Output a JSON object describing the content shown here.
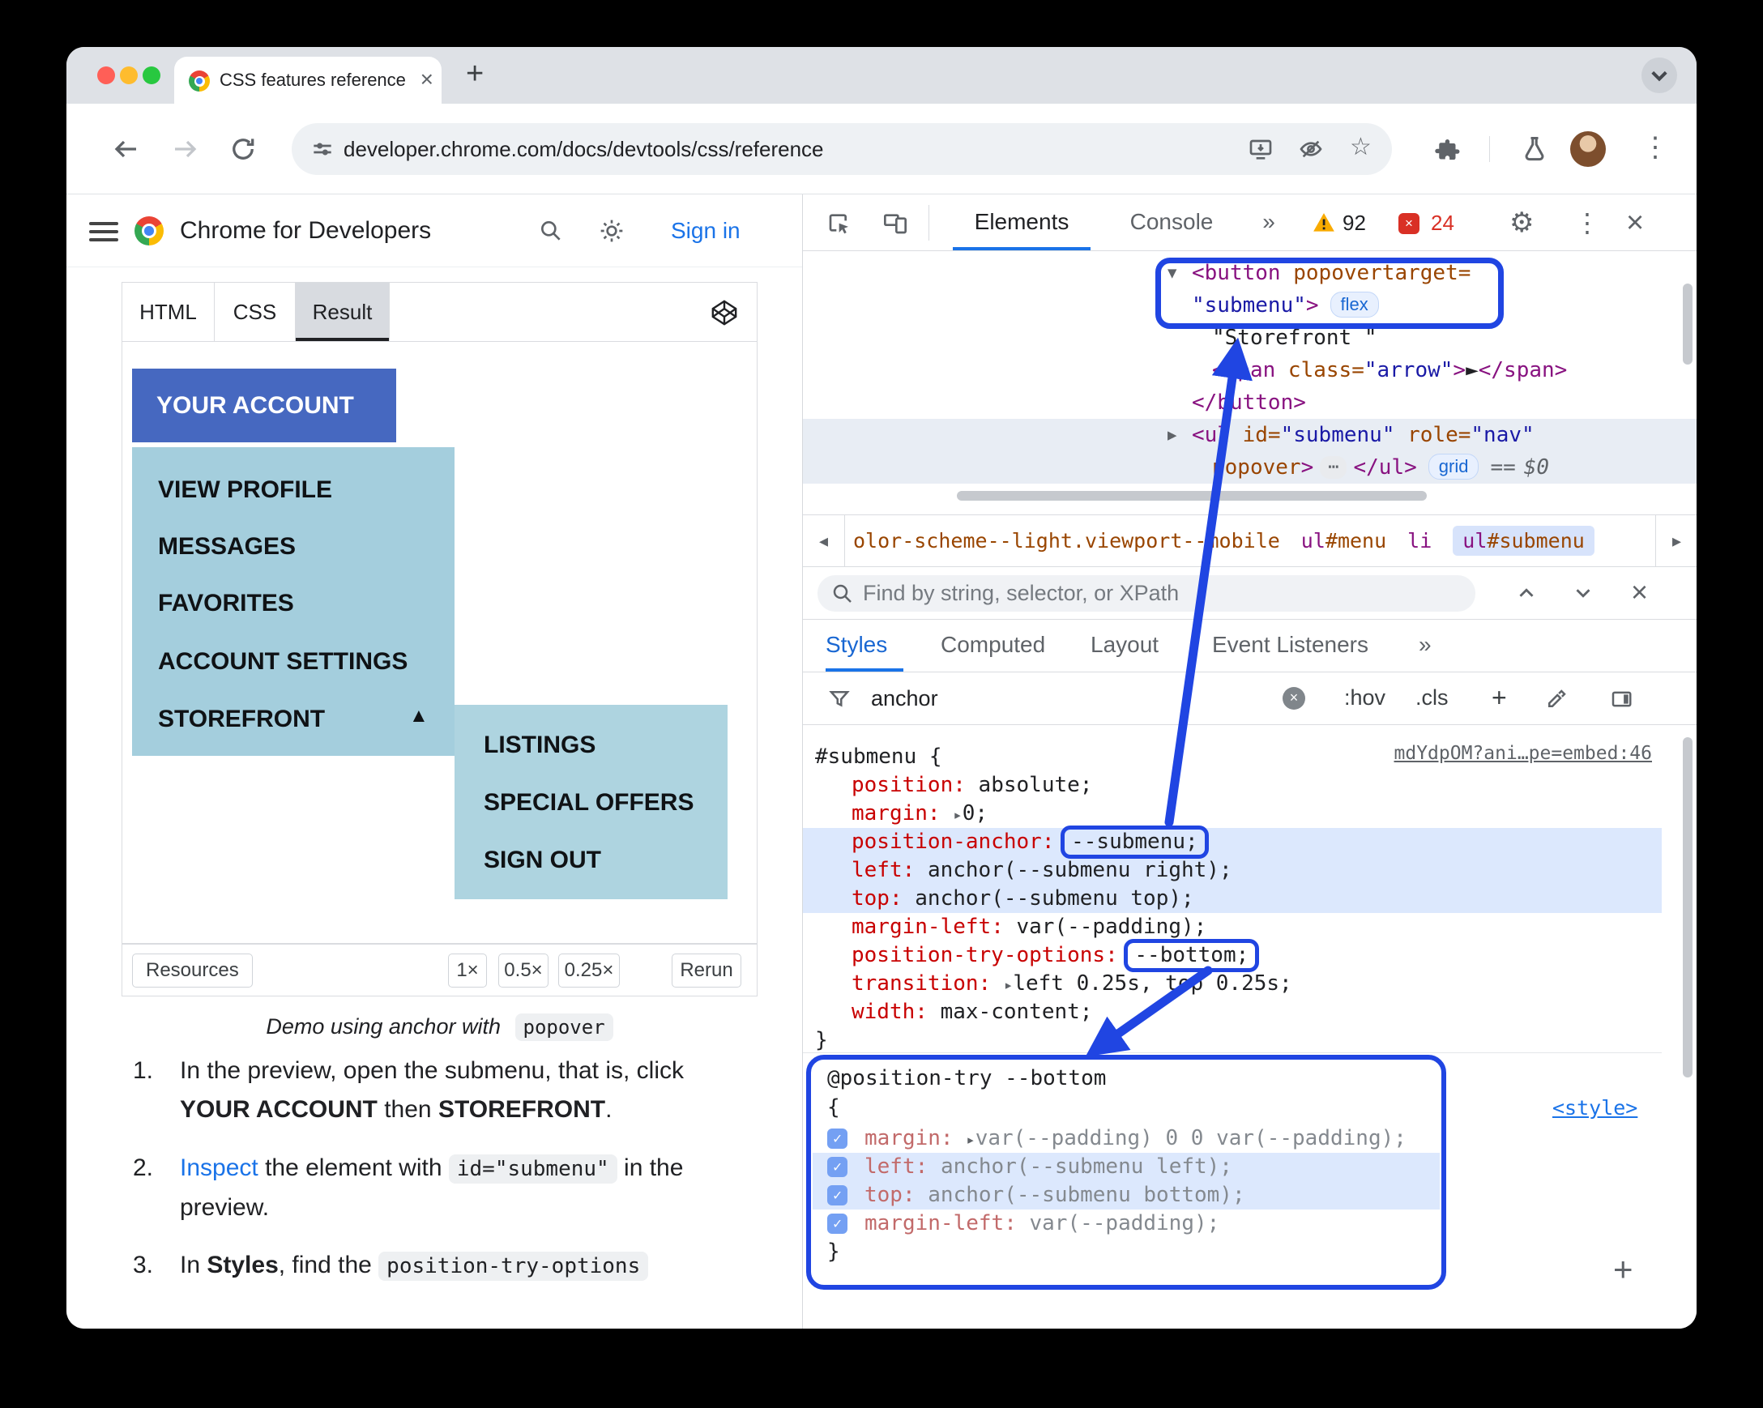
{
  "colors": {
    "annotation": "#2045e2",
    "accent": "#1a73e8",
    "account_button_bg": "#4668c0",
    "menu_bg": "#a4cedd",
    "submenu_bg": "#aed4e0"
  },
  "glyphs": {
    "new_tab": "+",
    "close": "×",
    "kebab": "⋮",
    "gear": "⚙",
    "star": "☆",
    "more": "»",
    "expand_small": "▸",
    "crumb_prev": "◂",
    "crumb_next": "▸",
    "check": "✓",
    "plus": "+",
    "clear": "×"
  },
  "browser": {
    "tab_title": "CSS features reference  |  Chr",
    "url": "developer.chrome.com/docs/devtools/css/reference"
  },
  "site": {
    "brand": "Chrome for Developers",
    "sign_in": "Sign in",
    "demo_tabs": [
      "HTML",
      "CSS",
      "Result"
    ],
    "account_button": "YOUR ACCOUNT",
    "menu_items": [
      "VIEW PROFILE",
      "MESSAGES",
      "FAVORITES",
      "ACCOUNT SETTINGS",
      "STOREFRONT"
    ],
    "menu_expand_marker": "▲",
    "submenu_items": [
      "LISTINGS",
      "SPECIAL OFFERS",
      "SIGN OUT"
    ],
    "resources_label": "Resources",
    "scale_options": [
      "1×",
      "0.5×",
      "0.25×"
    ],
    "rerun_label": "Rerun",
    "caption_text": "Demo using anchor with",
    "caption_code": "popover",
    "steps": [
      {
        "num": "1.",
        "r0": "In the preview, open the submenu, that is, click ",
        "r1": "YOUR ACCOUNT",
        "r2": " then ",
        "r3": "STOREFRONT",
        "r4": "."
      },
      {
        "num": "2.",
        "r0": "Inspect",
        "r1": " the element with ",
        "r2": "id=\"submenu\"",
        "r3": " in the preview."
      },
      {
        "num": "3.",
        "r0": "In ",
        "r1": "Styles",
        "r2": ", find the ",
        "r3": "position-try-options"
      }
    ]
  },
  "devtools": {
    "tabs": {
      "elements": "Elements",
      "console": "Console",
      "more": "»"
    },
    "warning_count": "92",
    "error_count": "24",
    "dom": {
      "l1": {
        "arrow": "▼",
        "tag": "<button ",
        "attr": "popovertarget="
      },
      "l2": {
        "value": "\"submenu\"",
        "tag": ">",
        "badge": "flex"
      },
      "l3": {
        "text": "\"Storefront \""
      },
      "l4": {
        "tag1": "<span ",
        "attr": "class=",
        "value": "\"arrow\"",
        "tag2": ">",
        "text": "►",
        "tag3": "</span>"
      },
      "l5": {
        "tag": "</button>"
      },
      "l6": {
        "arrow": "▶",
        "tag": "<ul ",
        "attr1": "id=",
        "value1": "\"submenu\"",
        "attr2": " role=",
        "value2": "\"nav\""
      },
      "l7": {
        "attr": "popover",
        "tag1": ">",
        "more": "⋯",
        "tag2": "</ul>",
        "badge": "grid",
        "eq": "==",
        "revision": "$0"
      }
    },
    "breadcrumbs": {
      "b0": "olor-scheme--light.viewport--mobile",
      "b1_tag": "ul",
      "b1_id": "#menu",
      "b2": "li",
      "b3_tag": "ul",
      "b3_id": "#submenu"
    },
    "find_placeholder": "Find by string, selector, or XPath",
    "panes": [
      "Styles",
      "Computed",
      "Layout",
      "Event Listeners"
    ],
    "panes_more": "»",
    "filter": {
      "value": "anchor",
      "hov": ":hov",
      "cls": ".cls",
      "add": "+"
    },
    "rule": {
      "selector": "#submenu {",
      "source_link": "mdYdpOM?ani…pe=embed:46",
      "close": "}",
      "decls": [
        {
          "p": "position",
          "v": "absolute;"
        },
        {
          "p": "margin",
          "v": "0;"
        },
        {
          "p": "position-anchor",
          "v": "--submenu;"
        },
        {
          "p": "left",
          "v": "anchor(--submenu right);"
        },
        {
          "p": "top",
          "v": "anchor(--submenu top);"
        },
        {
          "p": "margin-left",
          "v": "var(--padding);"
        },
        {
          "p": "position-try-options",
          "v": "--bottom;"
        },
        {
          "p": "transition",
          "v": "left 0.25s, top 0.25s;"
        },
        {
          "p": "width",
          "v": "max-content;"
        }
      ]
    },
    "position_try": {
      "at_rule": "@position-try --bottom",
      "open": "{",
      "close": "}",
      "style_link": "<style>",
      "decls": [
        {
          "p": "margin",
          "v": "var(--padding) 0 0 var(--padding);"
        },
        {
          "p": "left",
          "v": "anchor(--submenu left);"
        },
        {
          "p": "top",
          "v": "anchor(--submenu bottom);"
        },
        {
          "p": "margin-left",
          "v": "var(--padding);"
        }
      ]
    }
  }
}
